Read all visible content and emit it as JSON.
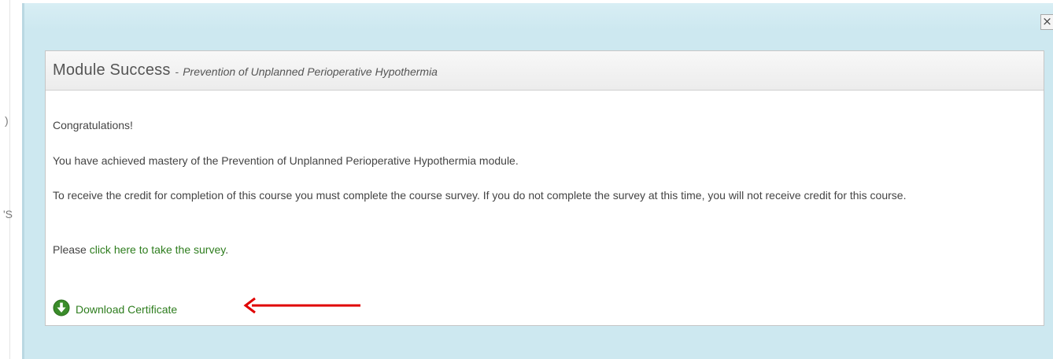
{
  "underlay": {
    "frag_a": ")",
    "frag_b": "'S"
  },
  "modal": {
    "close_glyph": "×"
  },
  "panel": {
    "title": "Module Success",
    "separator": "-",
    "subtitle": "Prevention of Unplanned Perioperative Hypothermia",
    "congrats": "Congratulations!",
    "mastery_text": "You have achieved mastery of the Prevention of Unplanned Perioperative Hypothermia module.",
    "credit_text": "To receive the credit for completion of this course you must complete the course survey. If you do not complete the survey at this time, you will not receive credit for this course.",
    "survey_prefix": "Please ",
    "survey_link": "click here to take the survey",
    "survey_suffix": ".",
    "download_label": "Download Certificate",
    "download_icon": "download-circle-icon"
  },
  "colors": {
    "modal_bg": "#cde8f0",
    "link_green": "#2e7d1e",
    "arrow_red": "#e00000"
  }
}
